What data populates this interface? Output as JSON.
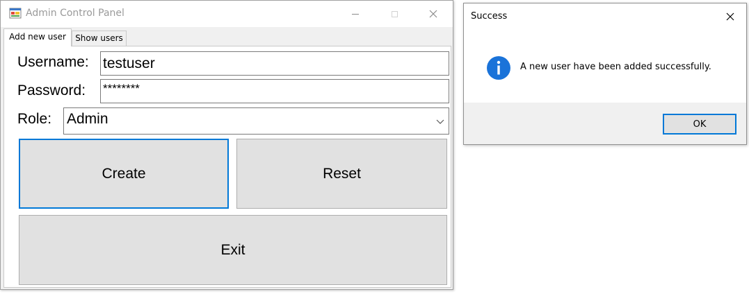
{
  "main_window": {
    "title": "Admin Control Panel",
    "tabs": [
      {
        "label": "Add new user",
        "active": true
      },
      {
        "label": "Show users",
        "active": false
      }
    ],
    "form": {
      "username_label": "Username:",
      "username_value": "testuser",
      "password_label": "Password:",
      "password_value": "********",
      "role_label": "Role:",
      "role_value": "Admin"
    },
    "buttons": {
      "create": "Create",
      "reset": "Reset",
      "exit": "Exit"
    },
    "icons": {
      "app": "app-icon",
      "minimize": "minimize-icon",
      "maximize": "maximize-icon",
      "close": "close-icon",
      "dropdown": "chevron-down-icon"
    }
  },
  "message_box": {
    "title": "Success",
    "message": "A new user have been added successfully.",
    "ok_label": "OK",
    "icons": {
      "info": "info-icon",
      "close": "close-icon"
    }
  },
  "colors": {
    "accent": "#0078d7",
    "button_face": "#e1e1e1",
    "window_bg": "#f0f0f0"
  }
}
